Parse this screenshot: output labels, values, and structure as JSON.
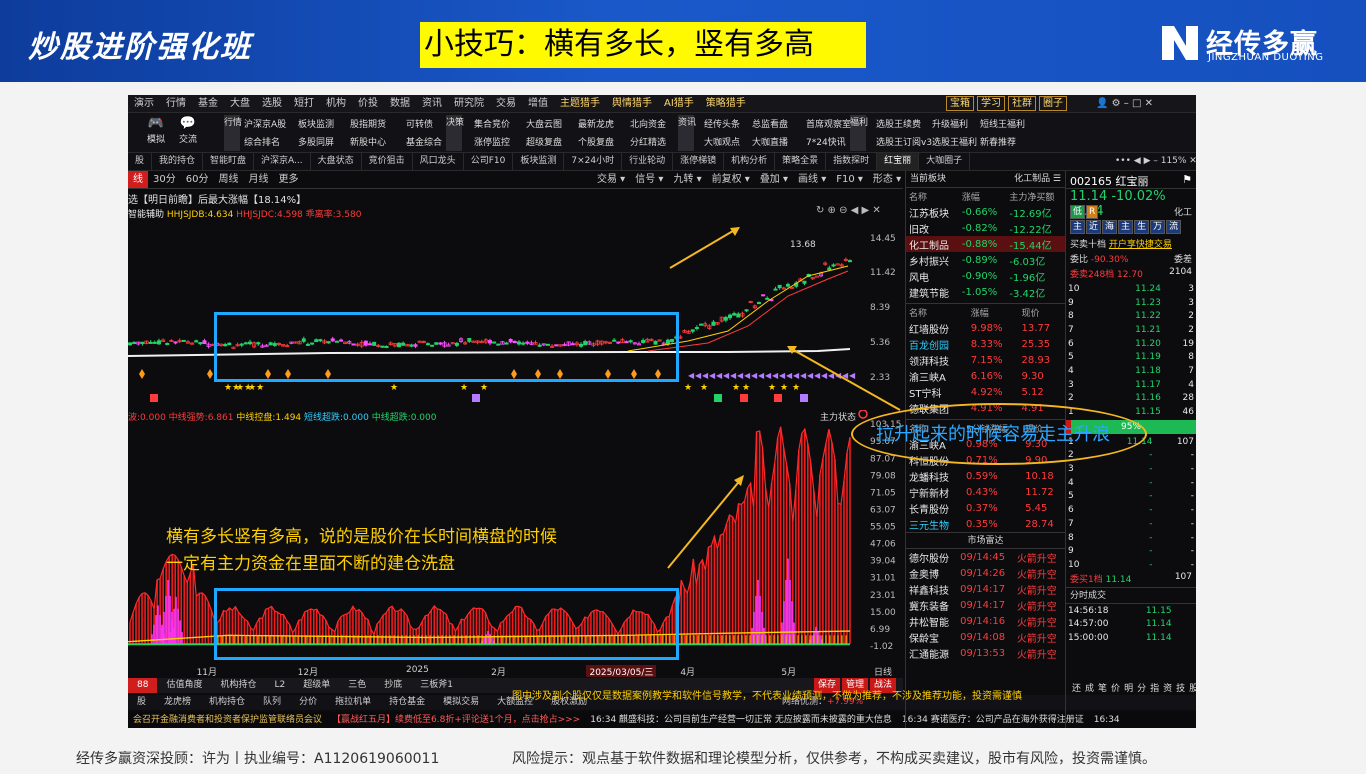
{
  "banner": {
    "course_title": "炒股进阶强化班",
    "tip": "小技巧：横有多长，竖有多高",
    "logo_cn": "经传多赢",
    "logo_en": "JINGZHUAN DUOYING"
  },
  "app": {
    "top_menu": [
      "演示",
      "行情",
      "基金",
      "大盘",
      "选股",
      "短打",
      "机构",
      "价投",
      "数据",
      "资讯",
      "研究院",
      "交易",
      "增值",
      "主题猎手",
      "舆情猎手",
      "AI猎手",
      "策略猎手"
    ],
    "top_menu_right": [
      "宝箱",
      "学习",
      "社群",
      "圈子"
    ],
    "toolbar_big": [
      {
        "icon": "🎮",
        "label": "模拟"
      },
      {
        "icon": "💬",
        "label": "交流"
      }
    ],
    "toolbar_vert": [
      "行情",
      "决策",
      "资讯",
      "福利"
    ],
    "toolbar_grid": [
      [
        "沪深京A股",
        "板块监测",
        "股指期货",
        "可转债"
      ],
      [
        "综合排名",
        "多股同屏",
        "新股中心",
        "基金综合"
      ],
      [
        "集合竞价",
        "大盘云图",
        "最新龙虎",
        "北向资金"
      ],
      [
        "涨停监控",
        "超级复盘",
        "个股复盘",
        "分红精选"
      ],
      [
        "经传头条",
        "总监看盘",
        "首席观察室"
      ],
      [
        "大咖观点",
        "大咖直播",
        "7*24快讯"
      ],
      [
        "选股王续费",
        "升级福利",
        "短线王福利"
      ],
      [
        "选股王订阅v3",
        "选股王福利",
        "新春推荐"
      ]
    ],
    "tabs": [
      "股",
      "我的持仓",
      "智能盯盘",
      "沪深京A...",
      "大盘状态",
      "竞价狙击",
      "风口龙头",
      "公司F10",
      "板块监测",
      "7×24小时",
      "行业轮动",
      "涨停梯镜",
      "机构分析",
      "策略全景",
      "指数探时",
      "红宝丽",
      "大咖圈子"
    ],
    "zoom": "115%",
    "periods": [
      "线",
      "30分",
      "60分",
      "周线",
      "月线",
      "更多"
    ],
    "period_tools": [
      "交易",
      "信号",
      "九转",
      "前复权",
      "叠加",
      "画线",
      "F10",
      "形态"
    ],
    "chart_title": "选【明日前瞻】后最大涨幅【18.14%】",
    "ind1_label": "智能辅助",
    "ind1_vals": [
      "HHJSJDB:4.634",
      "HHJSJDC:4.598",
      "乖离率:3.580"
    ],
    "ind2_vals": [
      "波:0.000",
      "中线强势:6.861",
      "中线控盘:1.494",
      "短线超跌:0.000",
      "中线超跌:0.000"
    ],
    "ind2_right": "主力状态",
    "kline_yaxis": [
      "14.45",
      "11.42",
      "8.39",
      "5.36",
      "2.33"
    ],
    "kline_high_label": "13.68",
    "vol_yaxis": [
      "103.15",
      "95.07",
      "87.07",
      "79.08",
      "71.05",
      "63.07",
      "55.05",
      "47.06",
      "39.04",
      "31.01",
      "23.01",
      "15.00",
      "6.99",
      "-1.02"
    ],
    "xaxis": [
      {
        "label": "11月",
        "x": 0.095
      },
      {
        "label": "12月",
        "x": 0.235
      },
      {
        "label": "2025",
        "x": 0.385
      },
      {
        "label": "2月",
        "x": 0.503
      },
      {
        "label": "2025/03/05/三",
        "x": 0.635
      },
      {
        "label": "4月",
        "x": 0.765
      },
      {
        "label": "5月",
        "x": 0.905
      }
    ],
    "xaxis_right": "日线",
    "bottom_tabs": [
      "88",
      "估值角度",
      "机构持仓",
      "L2",
      "超级单",
      "三色",
      "抄底",
      "三板斧1"
    ],
    "bottom_tabs2": [
      "股",
      "龙虎榜",
      "机构持仓",
      "队列",
      "分价",
      "拖拉机单",
      "持仓基金",
      "模拟交易",
      "大额监控",
      "股权激励"
    ],
    "save_btns": [
      "保存",
      "管理",
      "战法"
    ],
    "net_status": "网络优测：",
    "net_change": "+7.99%",
    "disclaimer_in_app": "图中涉及到个股仅仅是数据案例教学和软件信号教学，不代表业绩预测，不做为推荐，不涉及推荐功能，投资需谨慎",
    "ticker": [
      "会召开金融消费者和投资者保护监管联络员会议",
      "【赢战红五月】续费低至6.8折+评论送1个月，点击抢占>>>",
      "16:34 麒盛科技：公司目前生产经营一切正常 无应披露而未披露的重大信息",
      "16:34 赛诺医疗：公司产品在海外获得注册证",
      "16:34"
    ]
  },
  "sector_panel": {
    "header_left": "当前板块",
    "header_right": "化工制品",
    "cols": [
      "名称",
      "涨幅",
      "主力净买额"
    ],
    "rows": [
      {
        "name": "江苏板块",
        "chg": "-0.66%",
        "flow": "-12.69亿"
      },
      {
        "name": "旧改",
        "chg": "-0.82%",
        "flow": "-12.22亿"
      },
      {
        "name": "化工制品",
        "chg": "-0.88%",
        "flow": "-15.44亿",
        "sel": true
      },
      {
        "name": "乡村振兴",
        "chg": "-0.89%",
        "flow": "-6.03亿"
      },
      {
        "name": "风电",
        "chg": "-0.90%",
        "flow": "-1.96亿"
      },
      {
        "name": "建筑节能",
        "chg": "-1.05%",
        "flow": "-3.42亿"
      }
    ],
    "cols2": [
      "名称",
      "涨幅",
      "现价"
    ],
    "rows2": [
      {
        "name": "红墙股份",
        "chg": "9.98%",
        "price": "13.77"
      },
      {
        "name": "百龙创园",
        "chg": "8.33%",
        "price": "25.35",
        "cyan": true
      },
      {
        "name": "领湃科技",
        "chg": "7.15%",
        "price": "28.93"
      },
      {
        "name": "渝三峡A",
        "chg": "6.16%",
        "price": "9.30"
      },
      {
        "name": "ST宁科",
        "chg": "4.92%",
        "price": "5.12"
      },
      {
        "name": "德联集团",
        "chg": "4.91%",
        "price": "4.91"
      }
    ],
    "cols3": [
      "名称",
      "5分钟涨幅",
      "现价"
    ],
    "rows3": [
      {
        "name": "渝三峡A",
        "chg": "0.98%",
        "price": "9.30"
      },
      {
        "name": "科恒股份",
        "chg": "0.71%",
        "price": "9.90"
      },
      {
        "name": "龙蟠科技",
        "chg": "0.59%",
        "price": "10.18"
      },
      {
        "name": "宁新新材",
        "chg": "0.43%",
        "price": "11.72"
      },
      {
        "name": "长青股份",
        "chg": "0.37%",
        "price": "5.45"
      },
      {
        "name": "三元生物",
        "chg": "0.35%",
        "price": "28.74",
        "cyan": true
      }
    ],
    "radar_title": "市场雷达",
    "radar": [
      {
        "name": "德尔股份",
        "time": "09/14:45",
        "sig": "火箭升空"
      },
      {
        "name": "金奥博",
        "time": "09/14:26",
        "sig": "火箭升空"
      },
      {
        "name": "祥鑫科技",
        "time": "09/14:17",
        "sig": "火箭升空"
      },
      {
        "name": "冀东装备",
        "time": "09/14:17",
        "sig": "火箭升空"
      },
      {
        "name": "井松智能",
        "time": "09/14:16",
        "sig": "火箭升空"
      },
      {
        "name": "保龄宝",
        "time": "09/14:08",
        "sig": "火箭升空"
      },
      {
        "name": "汇通能源",
        "time": "09/13:53",
        "sig": "火箭升空"
      }
    ]
  },
  "stock_panel": {
    "code": "002165",
    "name": "红宝丽",
    "price": "11.14",
    "chg_pct": "-10.02%",
    "chg": "-1.24",
    "tag_low": "低",
    "tag_r": "R",
    "industry": "化工",
    "chips": [
      "主",
      "近",
      "海",
      "主",
      "生",
      "万",
      "流"
    ],
    "buttons": [
      "买卖十档",
      "开户享快捷交易"
    ],
    "ratio_label": "委比",
    "ratio": "-90.30%",
    "diff_label": "委差",
    "diff": "2104",
    "sell_label": "委卖248档",
    "sell_price": "12.70",
    "sell_vol": "2104",
    "book": [
      {
        "lv": "10",
        "p": "11.24",
        "v": "3"
      },
      {
        "lv": "9",
        "p": "11.23",
        "v": "3"
      },
      {
        "lv": "8",
        "p": "11.22",
        "v": "2"
      },
      {
        "lv": "7",
        "p": "11.21",
        "v": "2"
      },
      {
        "lv": "6",
        "p": "11.20",
        "v": "19"
      },
      {
        "lv": "5",
        "p": "11.19",
        "v": "8"
      },
      {
        "lv": "4",
        "p": "11.18",
        "v": "7"
      },
      {
        "lv": "3",
        "p": "11.17",
        "v": "4"
      },
      {
        "lv": "2",
        "p": "11.16",
        "v": "28"
      },
      {
        "lv": "1",
        "p": "11.15",
        "v": "46"
      }
    ],
    "bar_pct": "95%",
    "buy": [
      {
        "lv": "1",
        "p": "11.14",
        "v": "107"
      },
      {
        "lv": "2",
        "p": "-",
        "v": "-"
      },
      {
        "lv": "3",
        "p": "-",
        "v": "-"
      },
      {
        "lv": "4",
        "p": "-",
        "v": "-"
      },
      {
        "lv": "5",
        "p": "-",
        "v": "-"
      },
      {
        "lv": "6",
        "p": "-",
        "v": "-"
      },
      {
        "lv": "7",
        "p": "-",
        "v": "-"
      },
      {
        "lv": "8",
        "p": "-",
        "v": "-"
      },
      {
        "lv": "9",
        "p": "-",
        "v": "-"
      },
      {
        "lv": "10",
        "p": "-",
        "v": "-"
      }
    ],
    "buy_label": "委买1档",
    "buy_price": "11.14",
    "buy_vol": "107",
    "trades_title": "分时成交",
    "trades": [
      {
        "t": "14:56:18",
        "p": "11.15"
      },
      {
        "t": "14:57:00",
        "p": "11.14"
      },
      {
        "t": "15:00:00",
        "p": "11.14"
      }
    ],
    "bottom_icons": [
      "还",
      "成",
      "笔",
      "价",
      "明",
      "分",
      "指",
      "资",
      "技",
      "股"
    ]
  },
  "annotations": {
    "main_line1": "横有多长竖有多高，说的是股价在长时间横盘的时候",
    "main_line2": "一定有主力资金在里面不断的建仓洗盘",
    "ellipse_text": "拉升起来的时候容易走主升浪"
  },
  "footer": {
    "left": "经传多赢资深投顾：许为丨执业编号：A1120619060011",
    "right": "风险提示：观点基于软件数据和理论模型分析，仅供参考，不构成买卖建议，股市有风险，投资需谨慎。"
  },
  "colors": {
    "banner": "#1650bf",
    "up": "#ff3b3b",
    "down": "#22d36a",
    "highlight": "#fffa00",
    "box": "#1ea8ff",
    "ellipse": "#f5b820"
  }
}
